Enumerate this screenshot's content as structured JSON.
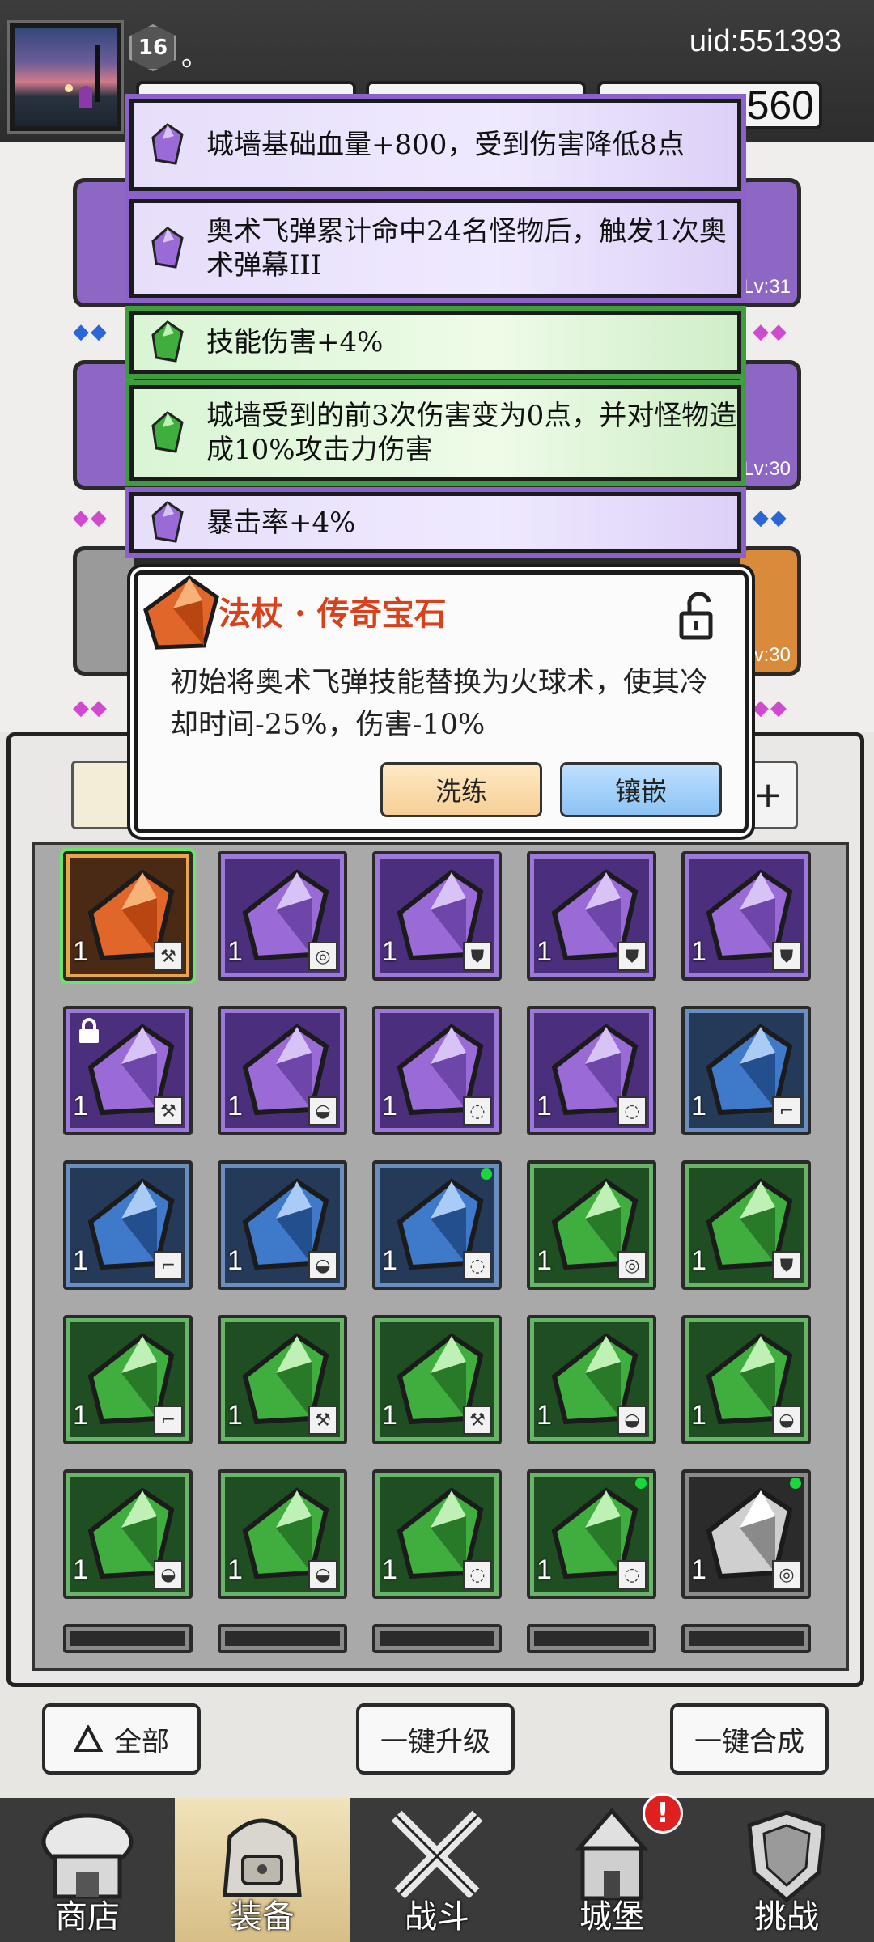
{
  "header": {
    "player_level": "16",
    "player_name": "。",
    "uid": "uid:551393",
    "resource_value": "560"
  },
  "affixes": [
    {
      "text": "城墙基础血量+800，受到伤害降低8点",
      "rarity": "purple"
    },
    {
      "text": "奥术飞弹累计命中24名怪物后，触发1次奥术弹幕III",
      "rarity": "purple"
    },
    {
      "text": "技能伤害+4%",
      "rarity": "green"
    },
    {
      "text": "城墙受到的前3次伤害变为0点，并对怪物造成10%攻击力伤害",
      "rarity": "green"
    },
    {
      "text": "暴击率+4%",
      "rarity": "purple"
    }
  ],
  "equipment_levels": [
    "Lv:31",
    "Lv:30",
    "Lv:30"
  ],
  "popup": {
    "title": "法杖 · 传奇宝石",
    "description": "初始将奥术飞弹技能替换为火球术，使其冷却时间-25%，伤害-10%",
    "refine_label": "洗练",
    "inlay_label": "镶嵌"
  },
  "inventory": {
    "rows": [
      [
        {
          "rarity": "legendary",
          "count": "1",
          "type": "staff"
        },
        {
          "rarity": "purple",
          "count": "1",
          "type": "ring"
        },
        {
          "rarity": "purple",
          "count": "1",
          "type": "armor"
        },
        {
          "rarity": "purple",
          "count": "1",
          "type": "armor"
        },
        {
          "rarity": "purple",
          "count": "1",
          "type": "armor"
        }
      ],
      [
        {
          "rarity": "purple",
          "count": "1",
          "type": "staff",
          "locked": true
        },
        {
          "rarity": "purple",
          "count": "1",
          "type": "hat"
        },
        {
          "rarity": "purple",
          "count": "1",
          "type": "necklace"
        },
        {
          "rarity": "purple",
          "count": "1",
          "type": "necklace"
        },
        {
          "rarity": "blue",
          "count": "1",
          "type": "boots"
        }
      ],
      [
        {
          "rarity": "blue",
          "count": "1",
          "type": "boots"
        },
        {
          "rarity": "blue",
          "count": "1",
          "type": "hat"
        },
        {
          "rarity": "blue",
          "count": "1",
          "type": "necklace",
          "new": true
        },
        {
          "rarity": "green",
          "count": "1",
          "type": "ring"
        },
        {
          "rarity": "green",
          "count": "1",
          "type": "armor"
        }
      ],
      [
        {
          "rarity": "green",
          "count": "1",
          "type": "boots"
        },
        {
          "rarity": "green",
          "count": "1",
          "type": "staff"
        },
        {
          "rarity": "green",
          "count": "1",
          "type": "staff"
        },
        {
          "rarity": "green",
          "count": "1",
          "type": "hat"
        },
        {
          "rarity": "green",
          "count": "1",
          "type": "hat"
        }
      ],
      [
        {
          "rarity": "green",
          "count": "1",
          "type": "hat"
        },
        {
          "rarity": "green",
          "count": "1",
          "type": "hat"
        },
        {
          "rarity": "green",
          "count": "1",
          "type": "necklace"
        },
        {
          "rarity": "green",
          "count": "1",
          "type": "necklace",
          "new": true
        },
        {
          "rarity": "white",
          "count": "1",
          "type": "ring",
          "new": true
        }
      ]
    ]
  },
  "actions": {
    "filter_label": "全部",
    "upgrade_all_label": "一键升级",
    "merge_all_label": "一键合成"
  },
  "nav": {
    "items": [
      {
        "label": "商店",
        "icon": "shop-icon"
      },
      {
        "label": "装备",
        "icon": "backpack-icon",
        "active": true
      },
      {
        "label": "战斗",
        "icon": "crossed-swords-icon"
      },
      {
        "label": "城堡",
        "icon": "castle-icon",
        "badge": "!"
      },
      {
        "label": "挑战",
        "icon": "shield-icon"
      }
    ]
  },
  "colors": {
    "legendary": "#e0662a",
    "purple": "#8b62c9",
    "blue": "#3f79c9",
    "green": "#3fae3f",
    "white": "#d0d0d0",
    "popup_title": "#d8411a"
  }
}
